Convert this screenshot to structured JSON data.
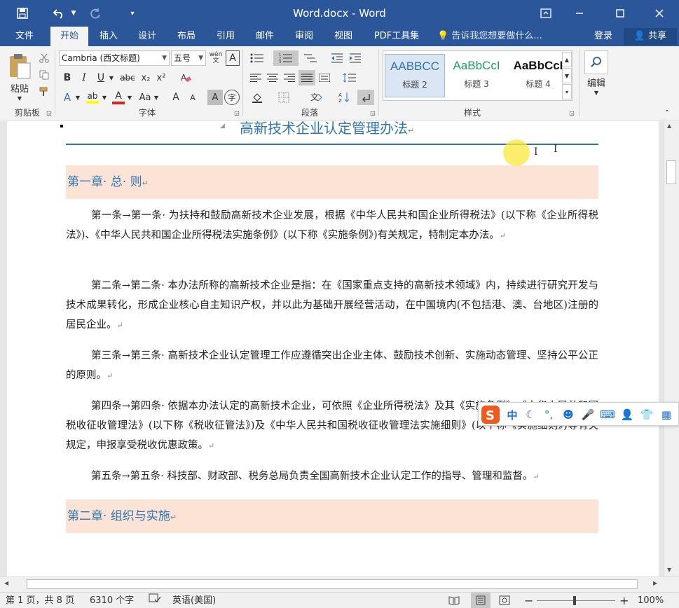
{
  "window": {
    "title": "Word.docx - Word"
  },
  "tabs": [
    {
      "label": "文件",
      "active": false
    },
    {
      "label": "开始",
      "active": true
    },
    {
      "label": "插入",
      "active": false
    },
    {
      "label": "设计",
      "active": false
    },
    {
      "label": "布局",
      "active": false
    },
    {
      "label": "引用",
      "active": false
    },
    {
      "label": "邮件",
      "active": false
    },
    {
      "label": "审阅",
      "active": false
    },
    {
      "label": "视图",
      "active": false
    },
    {
      "label": "PDF工具集",
      "active": false
    }
  ],
  "tellme": {
    "placeholder": "告诉我您想要做什么..."
  },
  "account": {
    "login": "登录",
    "share": "共享"
  },
  "ribbon": {
    "clipboard": {
      "paste": "粘贴",
      "group": "剪贴板"
    },
    "font": {
      "name": "Cambria (西文标题)",
      "size": "五号",
      "wen": "wén",
      "A_box": "A",
      "bold": "B",
      "italic": "I",
      "underline": "U",
      "strike": "abc",
      "sub": "x₂",
      "sup": "x²",
      "text_effect": "A",
      "highlight": "ab",
      "font_color": "A",
      "case": "Aa",
      "grow": "A",
      "shrink": "A",
      "char_shade": "A",
      "enclose": "字",
      "group": "字体"
    },
    "paragraph": {
      "group": "段落"
    },
    "styles": {
      "items": [
        {
          "sample": "AABBCC",
          "name": "标题 2",
          "color": "#2e74b5"
        },
        {
          "sample": "AaBbCcI",
          "name": "标题 3",
          "color": "#1f9e5a"
        },
        {
          "sample": "AaBbCcI",
          "name": "标题 4",
          "color": "#111111"
        }
      ],
      "group": "样式"
    },
    "editing": {
      "label": "编辑"
    }
  },
  "document": {
    "title": "高新技术企业认定管理办法",
    "chapter1": "第一章· 总· 则",
    "paragraphs": [
      "第一条→第一条· 为扶持和鼓励高新技术企业发展，根据《中华人民共和国企业所得税法》(以下称《企业所得税法》)、《中华人民共和国企业所得税法实施条例》(以下称《实施条例》)有关规定，特制定本办法。",
      "第二条→第二条· 本办法所称的高新技术企业是指：在《国家重点支持的高新技术领域》内，持续进行研究开发与技术成果转化，形成企业核心自主知识产权，并以此为基础开展经营活动，在中国境内(不包括港、澳、台地区)注册的居民企业。",
      "第三条→第三条· 高新技术企业认定管理工作应遵循突出企业主体、鼓励技术创新、实施动态管理、坚持公平公正的原则。",
      "第四条→第四条· 依据本办法认定的高新技术企业，可依照《企业所得税法》及其《实施条例》、《中华人民共和国税收征收管理法》(以下称《税收征管法》)及《中华人民共和国税收征收管理法实施细则》(以下称《实施细则》)等有关规定，申报享受税收优惠政策。",
      "第五条→第五条· 科技部、财政部、税务总局负责全国高新技术企业认定工作的指导、管理和监督。"
    ],
    "chapter2": "第二章· 组织与实施",
    "para_mark": "↵"
  },
  "ime": {
    "mode": "中"
  },
  "status": {
    "page": "第 1 页，共 8 页",
    "words": "6310 个字",
    "language": "英语(美国)",
    "zoom": "100%",
    "zoom_minus": "−",
    "zoom_plus": "+"
  },
  "colors": {
    "titlebar": "#2b579a",
    "heading": "#2e74b5",
    "chapter_bg": "#fbe4d5"
  }
}
